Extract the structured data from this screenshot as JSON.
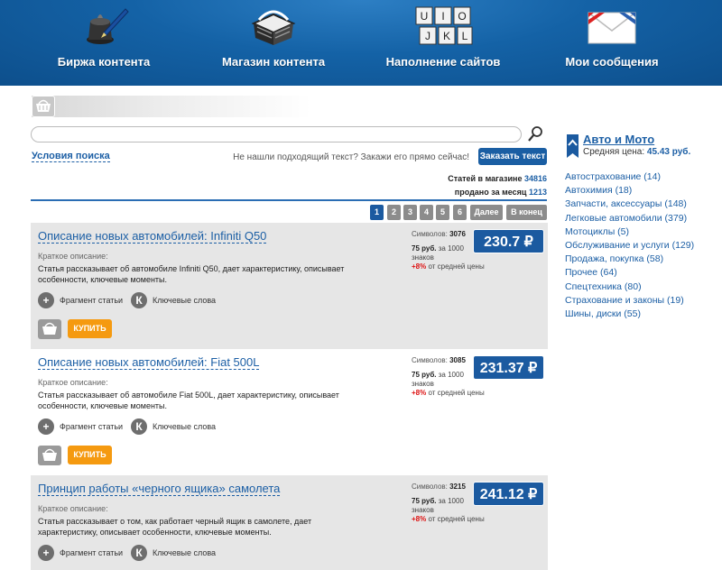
{
  "nav": [
    {
      "label": "Биржа контента",
      "icon": "inkwell-pen-icon"
    },
    {
      "label": "Магазин контента",
      "icon": "shopping-basket-icon"
    },
    {
      "label": "Наполнение сайтов",
      "icon": "keyboard-keys-icon"
    },
    {
      "label": "Мои сообщения",
      "icon": "envelope-icon"
    }
  ],
  "keys": [
    "U",
    "I",
    "O",
    "J",
    "K",
    "L"
  ],
  "search": {
    "value": "",
    "placeholder": ""
  },
  "search_conditions_link": "Условия поиска",
  "not_found_text": "Не нашли подходящий текст? Закажи его прямо сейчас!",
  "order_button": "Заказать текст",
  "stats": {
    "articles_label": "Статей в магазине",
    "articles_count": "34816",
    "sold_label": "продано за месяц",
    "sold_count": "1213"
  },
  "pagination": {
    "pages": [
      "1",
      "2",
      "3",
      "4",
      "5",
      "6"
    ],
    "active": "1",
    "next": "Далее",
    "last": "В конец"
  },
  "cards": [
    {
      "title": "Описание новых автомобилей: Infiniti Q50",
      "short_label": "Краткое описание:",
      "description": "Статья рассказывает об автомобиле Infiniti Q50, дает характеристику, описывает особенности, ключевые моменты.",
      "fragment_label": "Фрагмент статьи",
      "keywords_label": "Ключевые слова",
      "symbols_label": "Символов:",
      "symbols": "3076",
      "price_per": "75 руб.",
      "price_per_suffix": "за 1000 знаков",
      "pct": "+8%",
      "pct_suffix": "от средней цены",
      "price": "230.7 ₽",
      "buy_label": "КУПИТЬ"
    },
    {
      "title": "Описание новых автомобилей: Fiat 500L",
      "short_label": "Краткое описание:",
      "description": "Статья рассказывает об автомобиле Fiat 500L, дает характеристику, описывает особенности, ключевые моменты.",
      "fragment_label": "Фрагмент статьи",
      "keywords_label": "Ключевые слова",
      "symbols_label": "Символов:",
      "symbols": "3085",
      "price_per": "75 руб.",
      "price_per_suffix": "за 1000 знаков",
      "pct": "+8%",
      "pct_suffix": "от средней цены",
      "price": "231.37 ₽",
      "buy_label": "КУПИТЬ"
    },
    {
      "title": "Принцип работы «черного ящика» самолета",
      "short_label": "Краткое описание:",
      "description": "Статья рассказывает о том, как работает черный ящик в самолете, дает характеристику, описывает особенности, ключевые моменты.",
      "fragment_label": "Фрагмент статьи",
      "keywords_label": "Ключевые слова",
      "symbols_label": "Символов:",
      "symbols": "3215",
      "price_per": "75 руб.",
      "price_per_suffix": "за 1000 знаков",
      "pct": "+8%",
      "pct_suffix": "от средней цены",
      "price": "241.12 ₽",
      "buy_label": "КУПИТЬ"
    }
  ],
  "keyword_badge": "К",
  "sidebar": {
    "title": "Авто и Мото",
    "avg_label": "Средняя цена:",
    "avg_value": "45.43 руб.",
    "items": [
      "Автострахование (14)",
      "Автохимия (18)",
      "Запчасти, аксессуары (148)",
      "Легковые автомобили (379)",
      "Мотоциклы (5)",
      "Обслуживание и услуги (129)",
      "Продажа, покупка (58)",
      "Прочее (64)",
      "Спецтехника (80)",
      "Страхование и законы (19)",
      "Шины, диски (55)"
    ]
  },
  "colors": {
    "header_blue": "#1462a6",
    "link_blue": "#1c5fa5",
    "price_blue": "#1b5aa0",
    "buy_orange": "#f59a10",
    "card_gray": "#e6e6e6",
    "pct_red": "#dd1111"
  }
}
